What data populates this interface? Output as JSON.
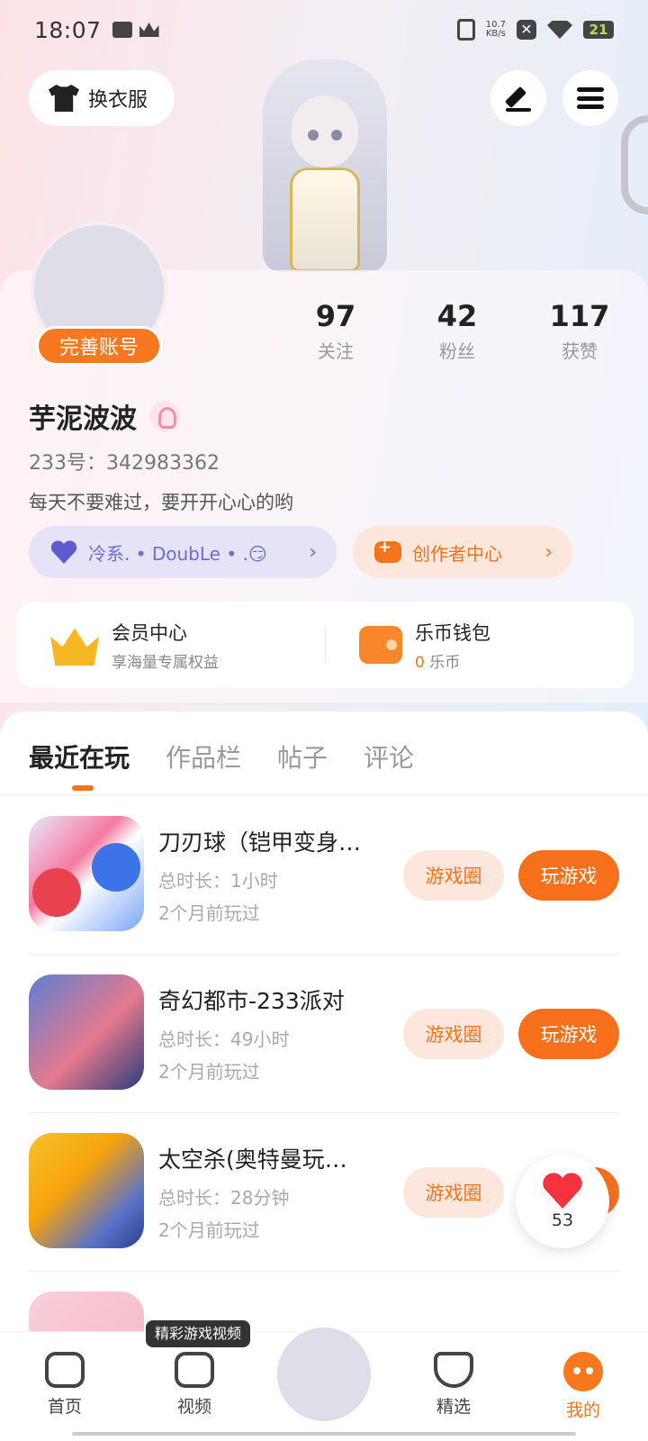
{
  "status_bar": {
    "time": "18:07",
    "speed": "10.7",
    "speed_unit": "KB/s",
    "battery": "21"
  },
  "header": {
    "outfit_label": "换衣服"
  },
  "profile": {
    "complete_label": "完善账号",
    "stats": [
      {
        "num": "97",
        "label": "关注"
      },
      {
        "num": "42",
        "label": "粉丝"
      },
      {
        "num": "117",
        "label": "获赞"
      }
    ],
    "username": "芋泥波波",
    "uid": "233号：342983362",
    "bio": "每天不要难过，要开开心心的哟",
    "family_label": "冷系. • DoubLe • .😏",
    "creator_label": "创作者中心"
  },
  "wallet": {
    "member_title": "会员中心",
    "member_sub": "享海量专属权益",
    "coins_title": "乐币钱包",
    "coins_value": "0",
    "coins_unit": "乐币"
  },
  "tabs": [
    "最近在玩",
    "作品栏",
    "帖子",
    "评论"
  ],
  "games": [
    {
      "title": "刀刃球（铠甲变身…",
      "time": "总时长：1小时",
      "last": "2个月前玩过",
      "circle": "游戏圈",
      "play": "玩游戏"
    },
    {
      "title": "奇幻都市-233派对",
      "time": "总时长：49小时",
      "last": "2个月前玩过",
      "circle": "游戏圈",
      "play": "玩游戏"
    },
    {
      "title": "太空杀(奥特曼玩…",
      "time": "总时长：28分钟",
      "last": "2个月前玩过",
      "circle": "游戏圈",
      "play": "玩游戏"
    }
  ],
  "like_float": {
    "count": "53"
  },
  "bottom_nav": {
    "tooltip": "精彩游戏视频",
    "items": [
      "首页",
      "视频",
      "精选",
      "我的"
    ]
  },
  "colors": {
    "accent": "#f4741c",
    "purple": "#6f6cd6"
  }
}
